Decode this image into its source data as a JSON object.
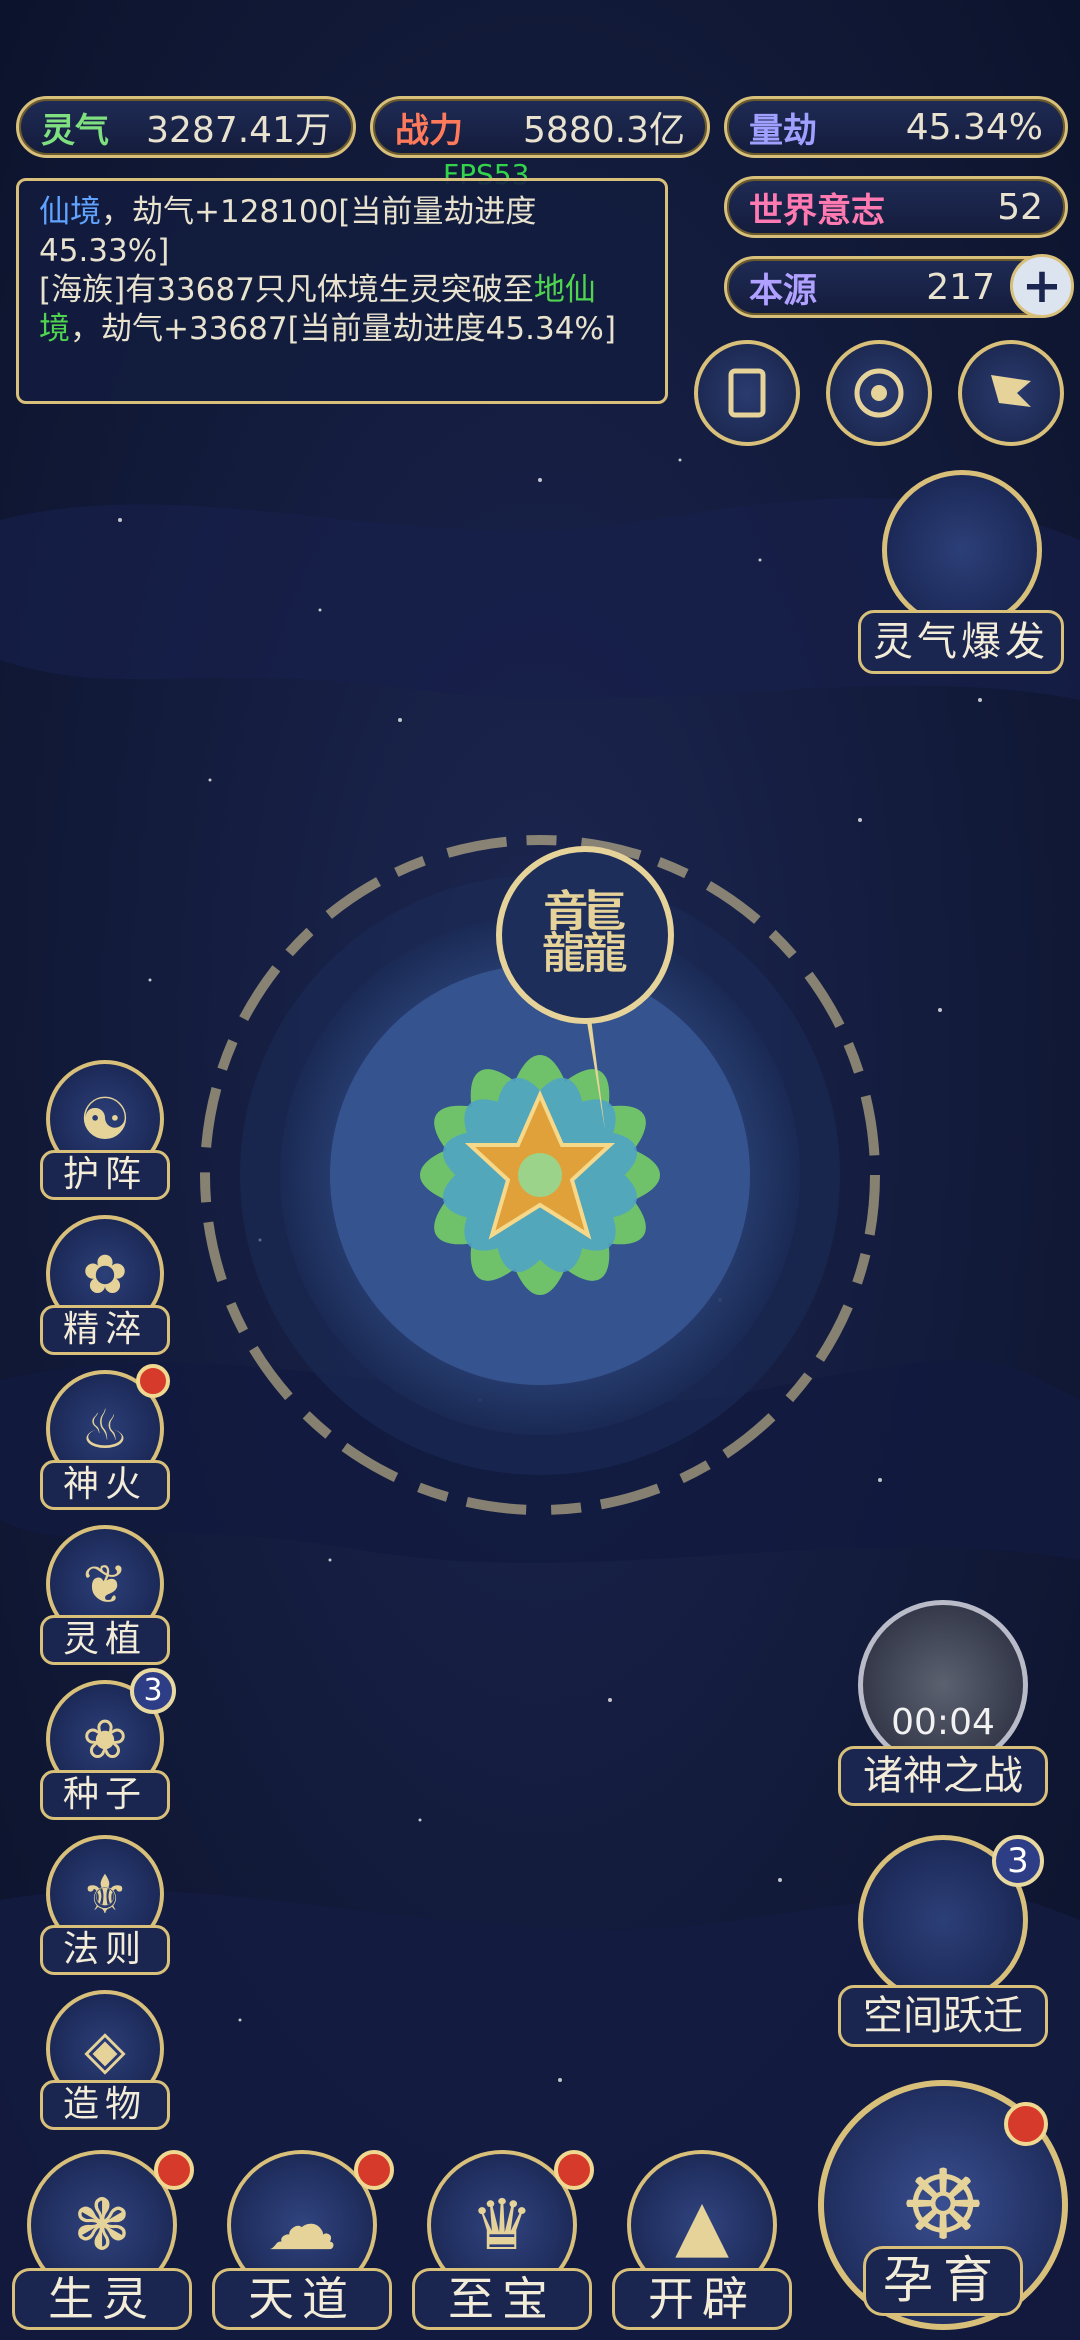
{
  "colors": {
    "gold": "#d8c07a",
    "bg": "#0f1731",
    "panel": "#141c3c",
    "badge_red": "#d63a2a"
  },
  "top_stats": {
    "spirit": {
      "label": "灵气",
      "value": "3287.41万"
    },
    "power": {
      "label": "战力",
      "value": "5880.3亿"
    },
    "calamity": {
      "label": "量劫",
      "value": "45.34%"
    },
    "world_will": {
      "label": "世界意志",
      "value": "52"
    },
    "origin": {
      "label": "本源",
      "value": "217"
    }
  },
  "fps": "FPS53",
  "log": {
    "line1_a": "仙境",
    "line1_b": "，劫气+128100[当前量劫进度45.33%]",
    "line2_a": "[海族]有33687只凡体境生灵突破至",
    "line2_b": "地仙境",
    "line2_c": "，劫气+33687[当前量劫进度45.34%]"
  },
  "right_icons": [
    "card-icon",
    "vortex-icon",
    "flag-icon"
  ],
  "spirit_burst": {
    "label": "灵气爆发"
  },
  "left_menu": [
    {
      "label": "护阵",
      "icon": "yin-yang-icon",
      "badge": null
    },
    {
      "label": "精淬",
      "icon": "flame-lotus-icon",
      "badge": null
    },
    {
      "label": "神火",
      "icon": "fire-icon",
      "badge": "dot"
    },
    {
      "label": "灵植",
      "icon": "plant-icon",
      "badge": null
    },
    {
      "label": "种子",
      "icon": "seed-icon",
      "badge": "3"
    },
    {
      "label": "法则",
      "icon": "rune-icon",
      "badge": null
    },
    {
      "label": "造物",
      "icon": "diamond-icon",
      "badge": null
    }
  ],
  "gods_war": {
    "label": "诸神之战",
    "timer": "00:04"
  },
  "space_jump": {
    "label": "空间跃迁",
    "badge": "3"
  },
  "bottom_menu": [
    {
      "label": "生灵",
      "badge": "dot"
    },
    {
      "label": "天道",
      "badge": "dot"
    },
    {
      "label": "至宝",
      "badge": "dot"
    },
    {
      "label": "开辟",
      "badge": null
    }
  ],
  "nurture": {
    "label": "孕育",
    "badge": "dot"
  }
}
